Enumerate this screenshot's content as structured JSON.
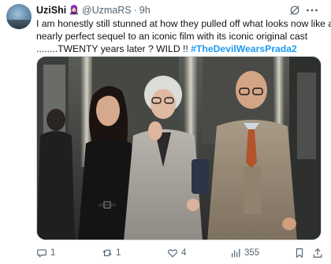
{
  "author": {
    "display_name": "UziShi",
    "emoji": "🧕🏻",
    "handle": "@UzmaRS",
    "separator": "·",
    "time": "9h"
  },
  "tweet": {
    "line1": "I am honestly still stunned at how they pulled off what looks now like a",
    "line2": "nearly perfect sequel to an iconic film with its iconic original cast",
    "line3_prefix": "........TWENTY years later ? WILD !! ",
    "hashtag": "#TheDevilWearsPrada2"
  },
  "actions": {
    "reply_count": "1",
    "retweet_count": "1",
    "like_count": "4",
    "views_count": "355"
  },
  "icons": [
    "grok-icon",
    "more-icon",
    "reply-icon",
    "retweet-icon",
    "like-icon",
    "views-icon",
    "bookmark-icon",
    "share-icon"
  ],
  "colors": {
    "link": "#1d9bf0",
    "muted": "#536471",
    "text": "#0f1419"
  }
}
